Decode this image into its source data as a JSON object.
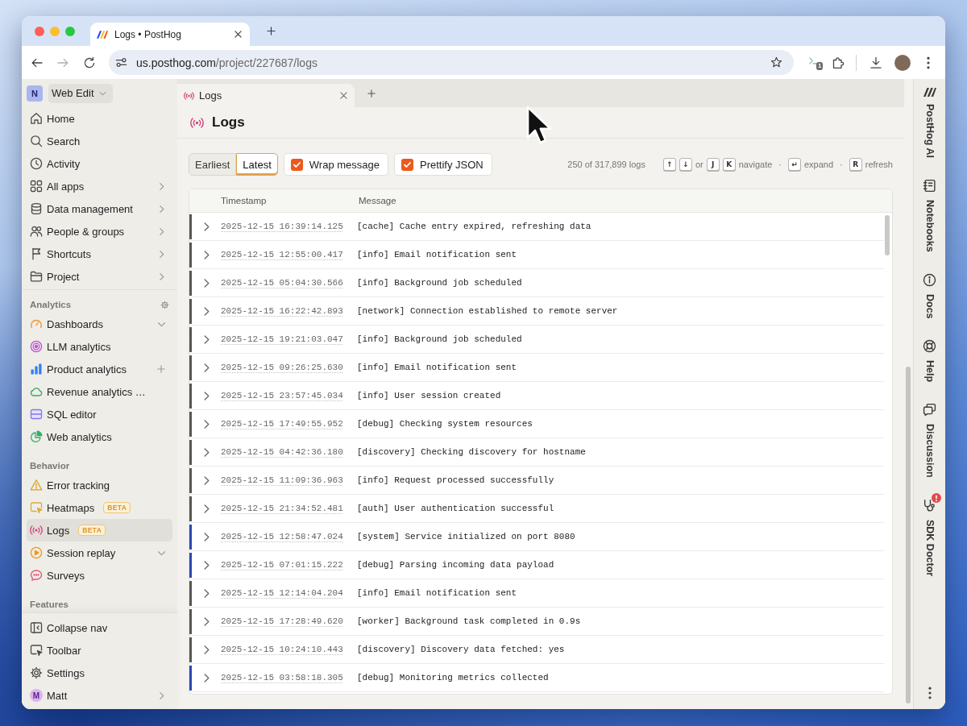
{
  "browser": {
    "tabs": [
      {
        "title": "Logs • PostHog",
        "selected": true
      }
    ],
    "address": {
      "host": "us.posthog.com",
      "path": "/project/227687/logs"
    },
    "extension_badge": "1"
  },
  "sidebar": {
    "workspace": {
      "initial": "N",
      "name": "Web Edit"
    },
    "sections": [
      {
        "items": [
          {
            "label": "Home",
            "kind": "link",
            "selected": false
          },
          {
            "label": "Search",
            "kind": "link",
            "selected": false
          },
          {
            "label": "Activity",
            "kind": "link",
            "selected": false
          },
          {
            "label": "All apps",
            "kind": "submenu",
            "selected": false
          },
          {
            "label": "Data management",
            "kind": "submenu",
            "selected": false
          },
          {
            "label": "People & groups",
            "kind": "submenu",
            "selected": false
          },
          {
            "label": "Shortcuts",
            "kind": "submenu",
            "selected": false
          },
          {
            "label": "Project",
            "kind": "submenu",
            "selected": false
          }
        ]
      },
      {
        "title": "Analytics",
        "items": [
          {
            "label": "Dashboards",
            "kind": "dropdown",
            "selected": false
          },
          {
            "label": "LLM analytics",
            "kind": "link",
            "selected": false
          },
          {
            "label": "Product analytics",
            "kind": "add",
            "selected": false
          },
          {
            "label": "Revenue analytics …",
            "kind": "link",
            "selected": false
          },
          {
            "label": "SQL editor",
            "kind": "link",
            "selected": false
          },
          {
            "label": "Web analytics",
            "kind": "link",
            "selected": false
          }
        ]
      },
      {
        "title": "Behavior",
        "items": [
          {
            "label": "Error tracking",
            "kind": "link",
            "selected": false
          },
          {
            "label": "Heatmaps",
            "kind": "link",
            "badge": "BETA",
            "selected": false
          },
          {
            "label": "Logs",
            "kind": "link",
            "badge": "BETA",
            "selected": true
          },
          {
            "label": "Session replay",
            "kind": "dropdown",
            "selected": false
          },
          {
            "label": "Surveys",
            "kind": "link",
            "selected": false
          }
        ]
      },
      {
        "title": "Features"
      }
    ],
    "footer": [
      {
        "label": "Collapse nav",
        "kind": "link"
      },
      {
        "label": "Toolbar",
        "kind": "link"
      },
      {
        "label": "Settings",
        "kind": "link"
      },
      {
        "label": "Matt",
        "kind": "submenu",
        "initial": "M"
      }
    ]
  },
  "page_tabs": [
    {
      "label": "Logs",
      "selected": true
    }
  ],
  "page": {
    "title": "Logs"
  },
  "toolbar": {
    "order": [
      {
        "label": "Earliest",
        "selected": false
      },
      {
        "label": "Latest",
        "selected": true
      }
    ],
    "options": [
      {
        "label": "Wrap message",
        "checked": true
      },
      {
        "label": "Prettify JSON",
        "checked": true
      }
    ],
    "count": "250 of 317,899 logs",
    "shortcuts": [
      {
        "kind": "key",
        "text": "↑"
      },
      {
        "kind": "key",
        "text": "↓"
      },
      {
        "kind": "word",
        "text": "or"
      },
      {
        "kind": "key",
        "text": "J"
      },
      {
        "kind": "key",
        "text": "K"
      },
      {
        "kind": "word",
        "text": "navigate"
      },
      {
        "kind": "separator",
        "text": "·"
      },
      {
        "kind": "key",
        "text": "↵"
      },
      {
        "kind": "word",
        "text": "expand"
      },
      {
        "kind": "separator",
        "text": "·"
      },
      {
        "kind": "key",
        "text": "R"
      },
      {
        "kind": "word",
        "text": "refresh"
      }
    ]
  },
  "table": {
    "columns": [
      "Timestamp",
      "Message"
    ],
    "rows": [
      {
        "timestamp": "2025-12-15 16:39:14.125",
        "message": "[cache] Cache entry expired, refreshing data",
        "color": "#565656",
        "expanded": false
      },
      {
        "timestamp": "2025-12-15 12:55:00.417",
        "message": "[info] Email notification sent",
        "color": "#565656",
        "expanded": false
      },
      {
        "timestamp": "2025-12-15 05:04:30.566",
        "message": "[info] Background job scheduled",
        "color": "#565656",
        "expanded": false
      },
      {
        "timestamp": "2025-12-15 16:22:42.893",
        "message": "[network] Connection established to remote server",
        "color": "#565656",
        "expanded": false
      },
      {
        "timestamp": "2025-12-15 19:21:03.047",
        "message": "[info] Background job scheduled",
        "color": "#565656",
        "expanded": false
      },
      {
        "timestamp": "2025-12-15 09:26:25.630",
        "message": "[info] Email notification sent",
        "color": "#565656",
        "expanded": false
      },
      {
        "timestamp": "2025-12-15 23:57:45.034",
        "message": "[info] User session created",
        "color": "#565656",
        "expanded": false
      },
      {
        "timestamp": "2025-12-15 17:49:55.952",
        "message": "[debug] Checking system resources",
        "color": "#565656",
        "expanded": false
      },
      {
        "timestamp": "2025-12-15 04:42:36.180",
        "message": "[discovery] Checking discovery for hostname",
        "color": "#565656",
        "expanded": false
      },
      {
        "timestamp": "2025-12-15 11:09:36.963",
        "message": "[info] Request processed successfully",
        "color": "#565656",
        "expanded": false
      },
      {
        "timestamp": "2025-12-15 21:34:52.481",
        "message": "[auth] User authentication successful",
        "color": "#565656",
        "expanded": false
      },
      {
        "timestamp": "2025-12-15 12:58:47.024",
        "message": "[system] Service initialized on port 8080",
        "color": "#2b46b5",
        "expanded": false
      },
      {
        "timestamp": "2025-12-15 07:01:15.222",
        "message": "[debug] Parsing incoming data payload",
        "color": "#2b46b5",
        "expanded": false
      },
      {
        "timestamp": "2025-12-15 12:14:04.204",
        "message": "[info] Email notification sent",
        "color": "#565656",
        "expanded": false
      },
      {
        "timestamp": "2025-12-15 17:28:49.620",
        "message": "[worker] Background task completed in 0.9s",
        "color": "#565656",
        "expanded": false
      },
      {
        "timestamp": "2025-12-15 10:24:10.443",
        "message": "[discovery] Discovery data fetched: yes",
        "color": "#565656",
        "expanded": false
      },
      {
        "timestamp": "2025-12-15 03:58:18.305",
        "message": "[debug] Monitoring metrics collected",
        "color": "#2b46b5",
        "expanded": false
      }
    ]
  },
  "side_panel": [
    {
      "label": "PostHog AI",
      "alert": false
    },
    {
      "label": "Notebooks",
      "alert": false
    },
    {
      "label": "Docs",
      "alert": false
    },
    {
      "label": "Help",
      "alert": false
    },
    {
      "label": "Discussion",
      "alert": false
    },
    {
      "label": "SDK Doctor",
      "alert": true
    }
  ]
}
